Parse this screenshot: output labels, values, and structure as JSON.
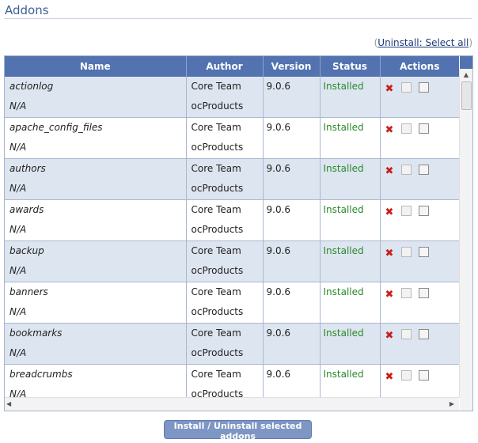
{
  "page": {
    "title": "Addons"
  },
  "toolbar": {
    "open_paren": "(",
    "uninstall_select_all": "Uninstall: Select all",
    "close_paren": ")"
  },
  "table": {
    "columns": [
      "Name",
      "Author",
      "Version",
      "Status",
      "Actions"
    ],
    "rows": [
      {
        "name": "actionlog",
        "description": "N/A",
        "author": "Core Team",
        "publisher": "ocProducts",
        "version": "9.0.6",
        "status": "Installed"
      },
      {
        "name": "apache_config_files",
        "description": "N/A",
        "author": "Core Team",
        "publisher": "ocProducts",
        "version": "9.0.6",
        "status": "Installed"
      },
      {
        "name": "authors",
        "description": "N/A",
        "author": "Core Team",
        "publisher": "ocProducts",
        "version": "9.0.6",
        "status": "Installed"
      },
      {
        "name": "awards",
        "description": "N/A",
        "author": "Core Team",
        "publisher": "ocProducts",
        "version": "9.0.6",
        "status": "Installed"
      },
      {
        "name": "backup",
        "description": "N/A",
        "author": "Core Team",
        "publisher": "ocProducts",
        "version": "9.0.6",
        "status": "Installed"
      },
      {
        "name": "banners",
        "description": "N/A",
        "author": "Core Team",
        "publisher": "ocProducts",
        "version": "9.0.6",
        "status": "Installed"
      },
      {
        "name": "bookmarks",
        "description": "N/A",
        "author": "Core Team",
        "publisher": "ocProducts",
        "version": "9.0.6",
        "status": "Installed"
      },
      {
        "name": "breadcrumbs",
        "description": "N/A",
        "author": "Core Team",
        "publisher": "ocProducts",
        "version": "9.0.6",
        "status": "Installed"
      }
    ]
  },
  "icons": {
    "delete": "delete-x-icon"
  },
  "colors": {
    "header_bg": "#5272b0",
    "status_installed": "#2a8a2a",
    "row_alt": "#dde5f0"
  },
  "footer": {
    "submit_label": "Install / Uninstall selected addons"
  }
}
